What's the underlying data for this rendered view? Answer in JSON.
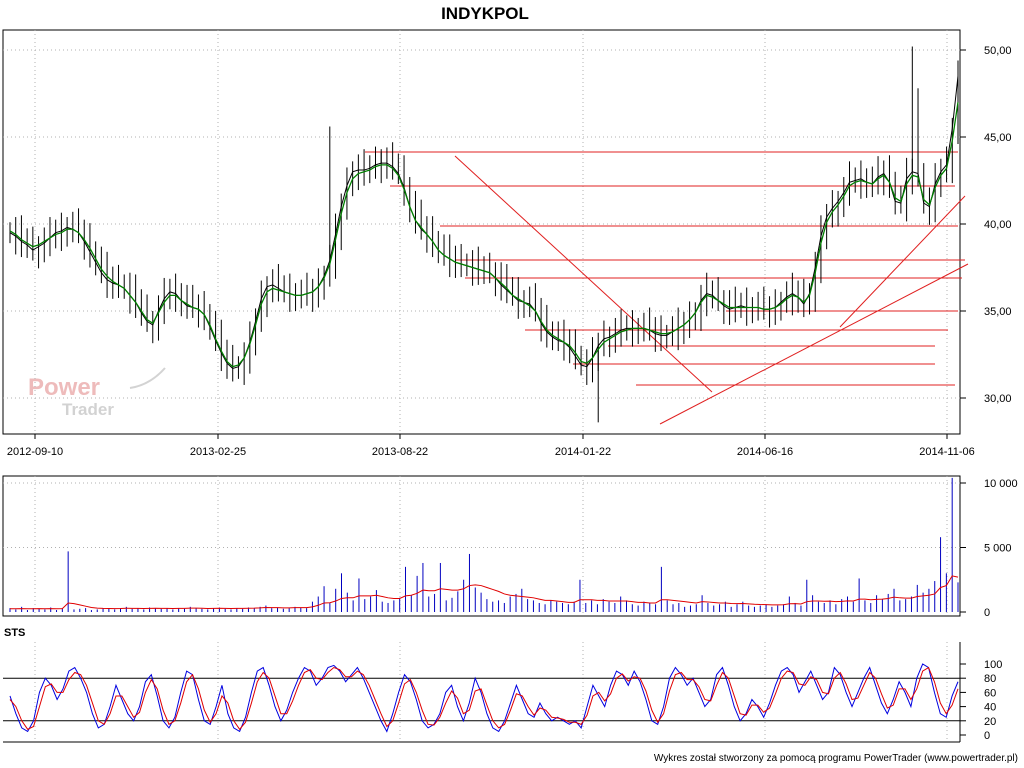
{
  "chart_data": [
    {
      "panel": "price",
      "type": "line",
      "title": "INDYKPOL",
      "x_tick_labels": [
        "2012-09-10",
        "2013-02-25",
        "2013-08-22",
        "2014-01-22",
        "2014-06-16",
        "2014-11-06"
      ],
      "y_tick_labels": [
        "30,00",
        "35,00",
        "40,00",
        "45,00",
        "50,00"
      ],
      "ylim": [
        28,
        50.3
      ],
      "grid": true,
      "series": [
        {
          "color": "#000000",
          "values": [
            39.5,
            39.3,
            39.0,
            38.8,
            38.5,
            38.7,
            38.9,
            39.2,
            39.5,
            39.6,
            39.8,
            39.7,
            39.5,
            39.0,
            38.4,
            37.8,
            37.2,
            36.8,
            36.6,
            36.5,
            36.3,
            35.9,
            35.5,
            34.9,
            34.4,
            34.2,
            35.0,
            35.7,
            36.1,
            36.0,
            35.6,
            35.3,
            35.2,
            35.1,
            34.8,
            34.1,
            33.3,
            32.6,
            32.0,
            31.7,
            31.8,
            32.3,
            33.2,
            34.4,
            35.7,
            36.4,
            36.5,
            36.3,
            36.1,
            36.0,
            35.9,
            35.9,
            36.0,
            36.1,
            36.4,
            37.0,
            37.9,
            39.4,
            41.0,
            42.2,
            43.0,
            43.1,
            43.1,
            43.2,
            43.4,
            43.5,
            43.5,
            43.3,
            42.9,
            42.1,
            41.0,
            40.2,
            39.7,
            39.4,
            39.0,
            38.5,
            38.2,
            38.0,
            37.8,
            37.7,
            37.6,
            37.5,
            37.4,
            37.3,
            37.2,
            36.9,
            36.5,
            36.2,
            35.9,
            35.6,
            35.5,
            35.4,
            35.0,
            34.3,
            33.8,
            33.5,
            33.3,
            33.2,
            32.9,
            32.4,
            31.9,
            31.8,
            32.3,
            33.0,
            33.4,
            33.5,
            33.7,
            33.9,
            34.0,
            34.0,
            34.0,
            34.0,
            33.9,
            33.7,
            33.6,
            33.6,
            33.8,
            34.0,
            34.2,
            34.5,
            34.9,
            35.6,
            36.0,
            35.9,
            35.6,
            35.3,
            35.1,
            35.2,
            35.3,
            35.2,
            35.2,
            35.2,
            35.1,
            35.1,
            35.2,
            35.5,
            35.8,
            36.0,
            35.8,
            35.4,
            36.0,
            37.5,
            39.3,
            40.4,
            40.9,
            41.3,
            41.8,
            42.4,
            42.5,
            42.6,
            42.4,
            42.3,
            42.7,
            42.9,
            42.4,
            41.3,
            41.2,
            42.6,
            43.0,
            42.9,
            41.2,
            41.0,
            42.3,
            43.0,
            43.4,
            45.5,
            48.5
          ]
        },
        {
          "color": "#008000",
          "values": [
            39.6,
            39.4,
            39.1,
            38.9,
            38.7,
            38.8,
            39.0,
            39.2,
            39.4,
            39.5,
            39.7,
            39.7,
            39.5,
            39.1,
            38.6,
            38.0,
            37.4,
            37.0,
            36.7,
            36.5,
            36.3,
            35.9,
            35.5,
            35.0,
            34.5,
            34.3,
            34.9,
            35.5,
            35.9,
            35.9,
            35.6,
            35.4,
            35.2,
            35.1,
            34.8,
            34.2,
            33.4,
            32.7,
            32.1,
            31.8,
            31.9,
            32.3,
            33.1,
            34.2,
            35.4,
            36.1,
            36.3,
            36.2,
            36.1,
            36.0,
            35.9,
            35.9,
            36.0,
            36.1,
            36.4,
            36.9,
            37.7,
            39.1,
            40.6,
            41.8,
            42.6,
            42.9,
            43.0,
            43.1,
            43.3,
            43.4,
            43.4,
            43.2,
            42.8,
            42.0,
            41.0,
            40.2,
            39.8,
            39.4,
            39.0,
            38.5,
            38.2,
            38.0,
            37.8,
            37.7,
            37.6,
            37.5,
            37.4,
            37.3,
            37.2,
            36.9,
            36.6,
            36.3,
            35.9,
            35.7,
            35.5,
            35.3,
            35.0,
            34.4,
            33.9,
            33.6,
            33.4,
            33.2,
            33.0,
            32.6,
            32.1,
            32.0,
            32.3,
            32.8,
            33.2,
            33.4,
            33.6,
            33.8,
            33.9,
            34.0,
            34.0,
            34.0,
            33.9,
            33.8,
            33.7,
            33.7,
            33.8,
            34.0,
            34.2,
            34.5,
            34.9,
            35.5,
            35.9,
            35.8,
            35.6,
            35.4,
            35.2,
            35.2,
            35.2,
            35.2,
            35.2,
            35.2,
            35.1,
            35.1,
            35.2,
            35.4,
            35.7,
            35.9,
            35.8,
            35.5,
            35.9,
            37.2,
            38.9,
            40.1,
            40.7,
            41.1,
            41.6,
            42.2,
            42.4,
            42.5,
            42.4,
            42.3,
            42.6,
            42.8,
            42.4,
            41.5,
            41.3,
            42.3,
            42.8,
            42.7,
            41.4,
            41.1,
            42.1,
            42.8,
            43.2,
            44.8,
            47.0
          ]
        }
      ]
    },
    {
      "panel": "volume",
      "type": "bar",
      "y_tick_labels": [
        "0",
        "5 000",
        "10 000"
      ],
      "ylim": [
        0,
        10000
      ],
      "grid": true,
      "series": [
        {
          "color": "#0000c0",
          "values": [
            300,
            200,
            400,
            150,
            300,
            250,
            200,
            350,
            150,
            300,
            4700,
            200,
            250,
            300,
            150,
            200,
            300,
            250,
            200,
            300,
            400,
            250,
            300,
            200,
            350,
            300,
            250,
            300,
            200,
            300,
            250,
            400,
            300,
            250,
            200,
            300,
            350,
            250,
            200,
            300,
            250,
            350,
            300,
            400,
            500,
            300,
            350,
            250,
            300,
            400,
            350,
            300,
            800,
            1200,
            2000,
            700,
            1800,
            3000,
            1500,
            900,
            2600,
            1000,
            1200,
            1700,
            800,
            700,
            900,
            1100,
            3500,
            1300,
            2800,
            3800,
            1200,
            1400,
            3800,
            900,
            1100,
            1600,
            2500,
            4500,
            1900,
            1500,
            1000,
            800,
            900,
            700,
            1200,
            1400,
            1800,
            1000,
            900,
            700,
            600,
            900,
            800,
            700,
            600,
            800,
            2500,
            700,
            900,
            600,
            1000,
            800,
            700,
            1200,
            900,
            600,
            500,
            800,
            700,
            600,
            3500,
            900,
            600,
            700,
            400,
            500,
            600,
            1300,
            700,
            500,
            600,
            800,
            400,
            600,
            800,
            500,
            400,
            500,
            600,
            400,
            500,
            600,
            1200,
            700,
            500,
            2500,
            1300,
            800,
            700,
            900,
            600,
            1000,
            1200,
            800,
            2600,
            900,
            700,
            1300,
            1000,
            1400,
            1800,
            900,
            1000,
            1200,
            2100,
            1500,
            1800,
            2400,
            5800,
            3000,
            10400,
            2300
          ]
        },
        {
          "color": "#e00000",
          "values": [
            250,
            250,
            260,
            250,
            250,
            260,
            250,
            260,
            250,
            260,
            700,
            650,
            550,
            450,
            350,
            300,
            280,
            270,
            260,
            270,
            290,
            280,
            280,
            270,
            280,
            290,
            280,
            280,
            270,
            280,
            280,
            300,
            300,
            290,
            270,
            280,
            290,
            280,
            270,
            280,
            280,
            290,
            300,
            320,
            350,
            340,
            340,
            320,
            320,
            340,
            340,
            340,
            400,
            520,
            700,
            720,
            850,
            1050,
            1100,
            1100,
            1250,
            1250,
            1250,
            1300,
            1200,
            1100,
            1050,
            1050,
            1250,
            1300,
            1450,
            1700,
            1650,
            1650,
            1800,
            1750,
            1700,
            1700,
            1800,
            2050,
            2100,
            2050,
            1900,
            1750,
            1600,
            1400,
            1300,
            1250,
            1200,
            1150,
            1100,
            1000,
            900,
            900,
            850,
            800,
            750,
            750,
            950,
            950,
            950,
            900,
            900,
            850,
            850,
            850,
            850,
            800,
            750,
            750,
            700,
            700,
            950,
            950,
            900,
            850,
            800,
            750,
            700,
            800,
            780,
            740,
            700,
            700,
            660,
            650,
            660,
            630,
            600,
            580,
            570,
            550,
            550,
            560,
            640,
            650,
            620,
            800,
            850,
            850,
            830,
            840,
            800,
            820,
            860,
            850,
            1000,
            1000,
            950,
            980,
            1000,
            1050,
            1150,
            1100,
            1080,
            1080,
            1200,
            1250,
            1300,
            1400,
            1900,
            2050,
            2800,
            2700
          ]
        }
      ]
    },
    {
      "panel": "oscillator",
      "type": "line",
      "title": "STS",
      "y_tick_labels": [
        "0",
        "20",
        "40",
        "60",
        "80",
        "100"
      ],
      "ylim": [
        0,
        100
      ],
      "reference_lines": [
        20,
        80
      ],
      "series": [
        {
          "color": "#0000e0",
          "values": [
            55,
            30,
            10,
            5,
            20,
            60,
            80,
            70,
            50,
            65,
            90,
            95,
            80,
            60,
            30,
            10,
            15,
            40,
            70,
            50,
            30,
            20,
            40,
            75,
            85,
            55,
            20,
            10,
            25,
            60,
            90,
            85,
            50,
            20,
            15,
            40,
            70,
            30,
            10,
            5,
            25,
            60,
            90,
            95,
            70,
            40,
            20,
            35,
            60,
            80,
            95,
            90,
            70,
            80,
            95,
            98,
            90,
            75,
            85,
            95,
            80,
            60,
            40,
            20,
            5,
            30,
            60,
            85,
            75,
            50,
            20,
            10,
            15,
            30,
            60,
            70,
            40,
            20,
            45,
            80,
            60,
            30,
            10,
            5,
            20,
            45,
            70,
            50,
            30,
            25,
            45,
            30,
            20,
            25,
            20,
            15,
            20,
            10,
            40,
            70,
            55,
            40,
            70,
            90,
            85,
            70,
            90,
            75,
            50,
            20,
            15,
            40,
            80,
            95,
            85,
            70,
            80,
            60,
            40,
            50,
            85,
            95,
            70,
            40,
            20,
            30,
            50,
            40,
            25,
            45,
            70,
            90,
            95,
            85,
            60,
            75,
            90,
            70,
            50,
            60,
            95,
            85,
            60,
            40,
            60,
            80,
            95,
            70,
            45,
            30,
            50,
            75,
            60,
            40,
            80,
            100,
            95,
            60,
            30,
            25,
            55,
            75
          ]
        },
        {
          "color": "#e00000",
          "values": [
            50,
            40,
            20,
            8,
            12,
            40,
            68,
            72,
            60,
            60,
            78,
            88,
            85,
            70,
            45,
            20,
            15,
            30,
            55,
            55,
            40,
            25,
            32,
            60,
            78,
            65,
            35,
            15,
            20,
            45,
            75,
            85,
            65,
            35,
            18,
            30,
            55,
            45,
            20,
            8,
            18,
            45,
            75,
            88,
            80,
            55,
            30,
            30,
            48,
            70,
            88,
            92,
            80,
            78,
            88,
            95,
            92,
            82,
            82,
            90,
            85,
            70,
            50,
            30,
            12,
            20,
            45,
            72,
            78,
            60,
            35,
            15,
            14,
            25,
            45,
            62,
            52,
            30,
            35,
            62,
            65,
            42,
            20,
            10,
            15,
            35,
            58,
            55,
            40,
            28,
            38,
            35,
            25,
            24,
            22,
            18,
            18,
            15,
            28,
            55,
            60,
            48,
            58,
            80,
            86,
            76,
            82,
            80,
            62,
            35,
            18,
            30,
            62,
            85,
            88,
            78,
            78,
            68,
            50,
            48,
            70,
            88,
            80,
            55,
            30,
            28,
            42,
            42,
            32,
            38,
            58,
            80,
            90,
            88,
            72,
            70,
            82,
            78,
            60,
            58,
            80,
            88,
            72,
            50,
            52,
            70,
            88,
            80,
            58,
            38,
            42,
            65,
            65,
            50,
            65,
            90,
            95,
            75,
            45,
            30,
            42,
            65
          ]
        }
      ]
    }
  ],
  "footer": "Wykres został stworzony za pomocą programu PowerTrader (www.powertrader.pl)",
  "watermark": {
    "line1": "Power",
    "line2": "Trader"
  }
}
